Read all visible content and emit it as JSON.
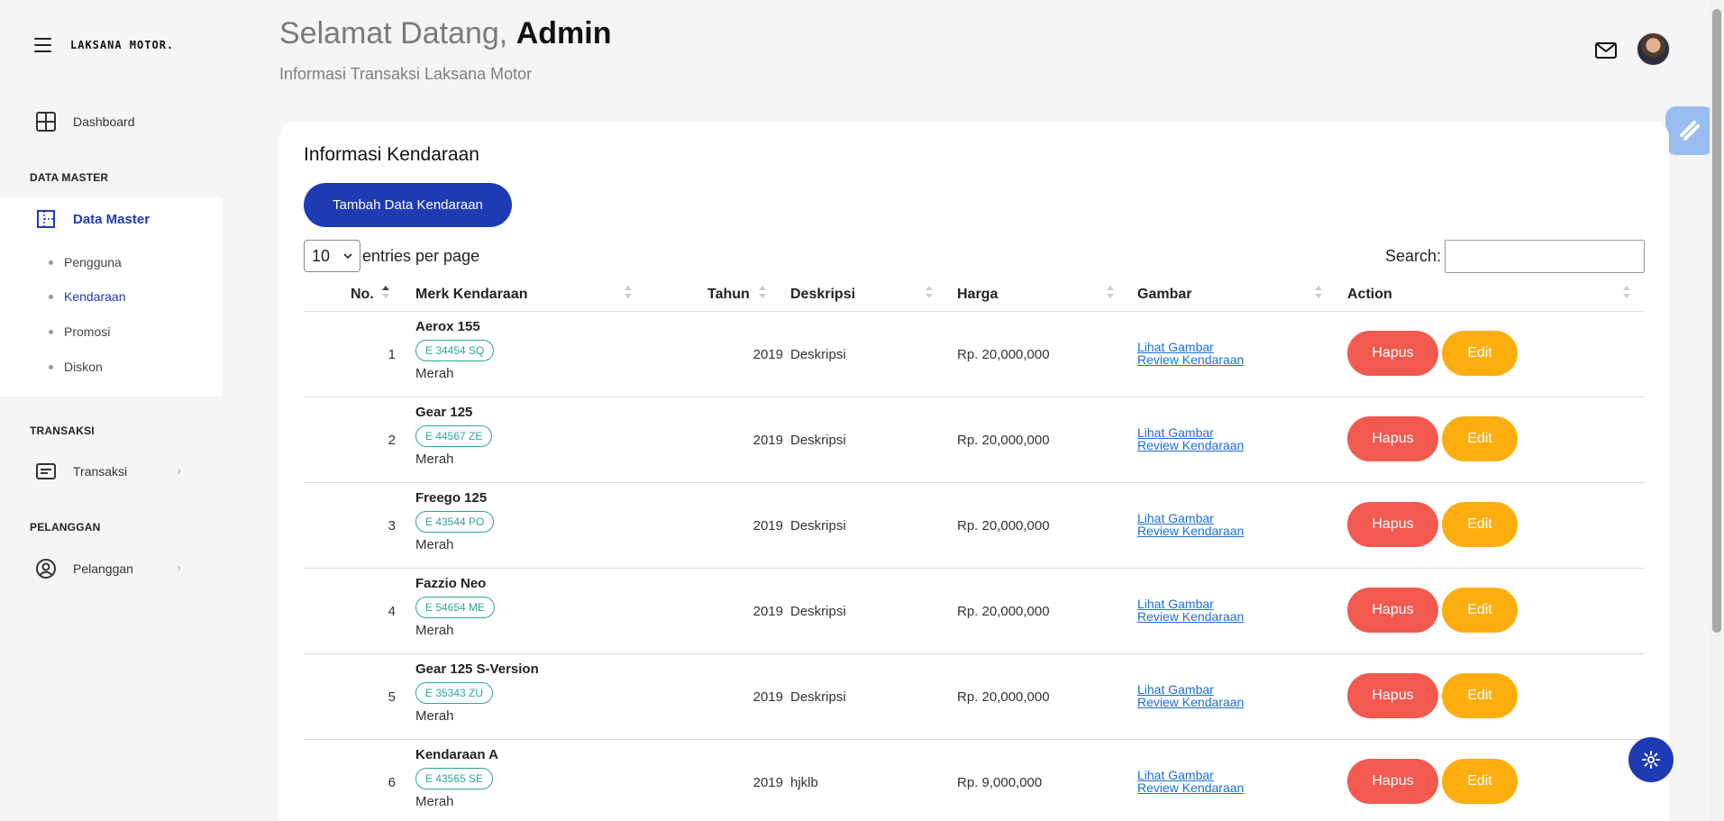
{
  "brand": {
    "logo": "LAKSANA MOTOR."
  },
  "sidebar": {
    "dashboard": "Dashboard",
    "section_master": "DATA MASTER",
    "data_master": "Data Master",
    "sub_items": [
      "Pengguna",
      "Kendaraan",
      "Promosi",
      "Diskon"
    ],
    "section_transaksi": "TRANSAKSI",
    "transaksi": "Transaksi",
    "section_pelanggan": "PELANGGAN",
    "pelanggan": "Pelanggan"
  },
  "header": {
    "greeting": "Selamat Datang,",
    "user": "Admin",
    "subtitle": "Informasi Transaksi Laksana Motor"
  },
  "card": {
    "title": "Informasi Kendaraan",
    "add_button": "Tambah Data Kendaraan",
    "entries_value": "10",
    "entries_label": "entries per page",
    "search_label": "Search:"
  },
  "table": {
    "headers": [
      "No.",
      "Merk Kendaraan",
      "Tahun",
      "Deskripsi",
      "Harga",
      "Gambar",
      "Action"
    ],
    "rows": [
      {
        "no": "1",
        "name": "Aerox 155",
        "plate": "E 34454 SQ",
        "color": "Merah",
        "tahun": "2019",
        "deskripsi": "Deskripsi",
        "harga": "Rp. 20,000,000"
      },
      {
        "no": "2",
        "name": "Gear 125",
        "plate": "E 44567 ZE",
        "color": "Merah",
        "tahun": "2019",
        "deskripsi": "Deskripsi",
        "harga": "Rp. 20,000,000"
      },
      {
        "no": "3",
        "name": "Freego 125",
        "plate": "E 43544 PO",
        "color": "Merah",
        "tahun": "2019",
        "deskripsi": "Deskripsi",
        "harga": "Rp. 20,000,000"
      },
      {
        "no": "4",
        "name": "Fazzio Neo",
        "plate": "E 54654 ME",
        "color": "Merah",
        "tahun": "2019",
        "deskripsi": "Deskripsi",
        "harga": "Rp. 20,000,000"
      },
      {
        "no": "5",
        "name": "Gear 125 S-Version",
        "plate": "E 35343 ZU",
        "color": "Merah",
        "tahun": "2019",
        "deskripsi": "Deskripsi",
        "harga": "Rp. 20,000,000"
      },
      {
        "no": "6",
        "name": "Kendaraan A",
        "plate": "E 43565 SE",
        "color": "Merah",
        "tahun": "2019",
        "deskripsi": "hjklb",
        "harga": "Rp. 9,000,000"
      }
    ],
    "link_view": "Lihat Gambar",
    "link_review": "Review Kendaraan",
    "btn_delete": "Hapus",
    "btn_edit": "Edit"
  },
  "colors": {
    "primary": "#1f3bb3",
    "danger": "#f2594f",
    "warning": "#fdae0f",
    "plate": "#2ea59b"
  },
  "icons": [
    "hamburger-icon",
    "dashboard-grid-icon",
    "data-master-icon",
    "transaksi-icon",
    "pelanggan-icon",
    "mail-icon",
    "gear-icon"
  ]
}
